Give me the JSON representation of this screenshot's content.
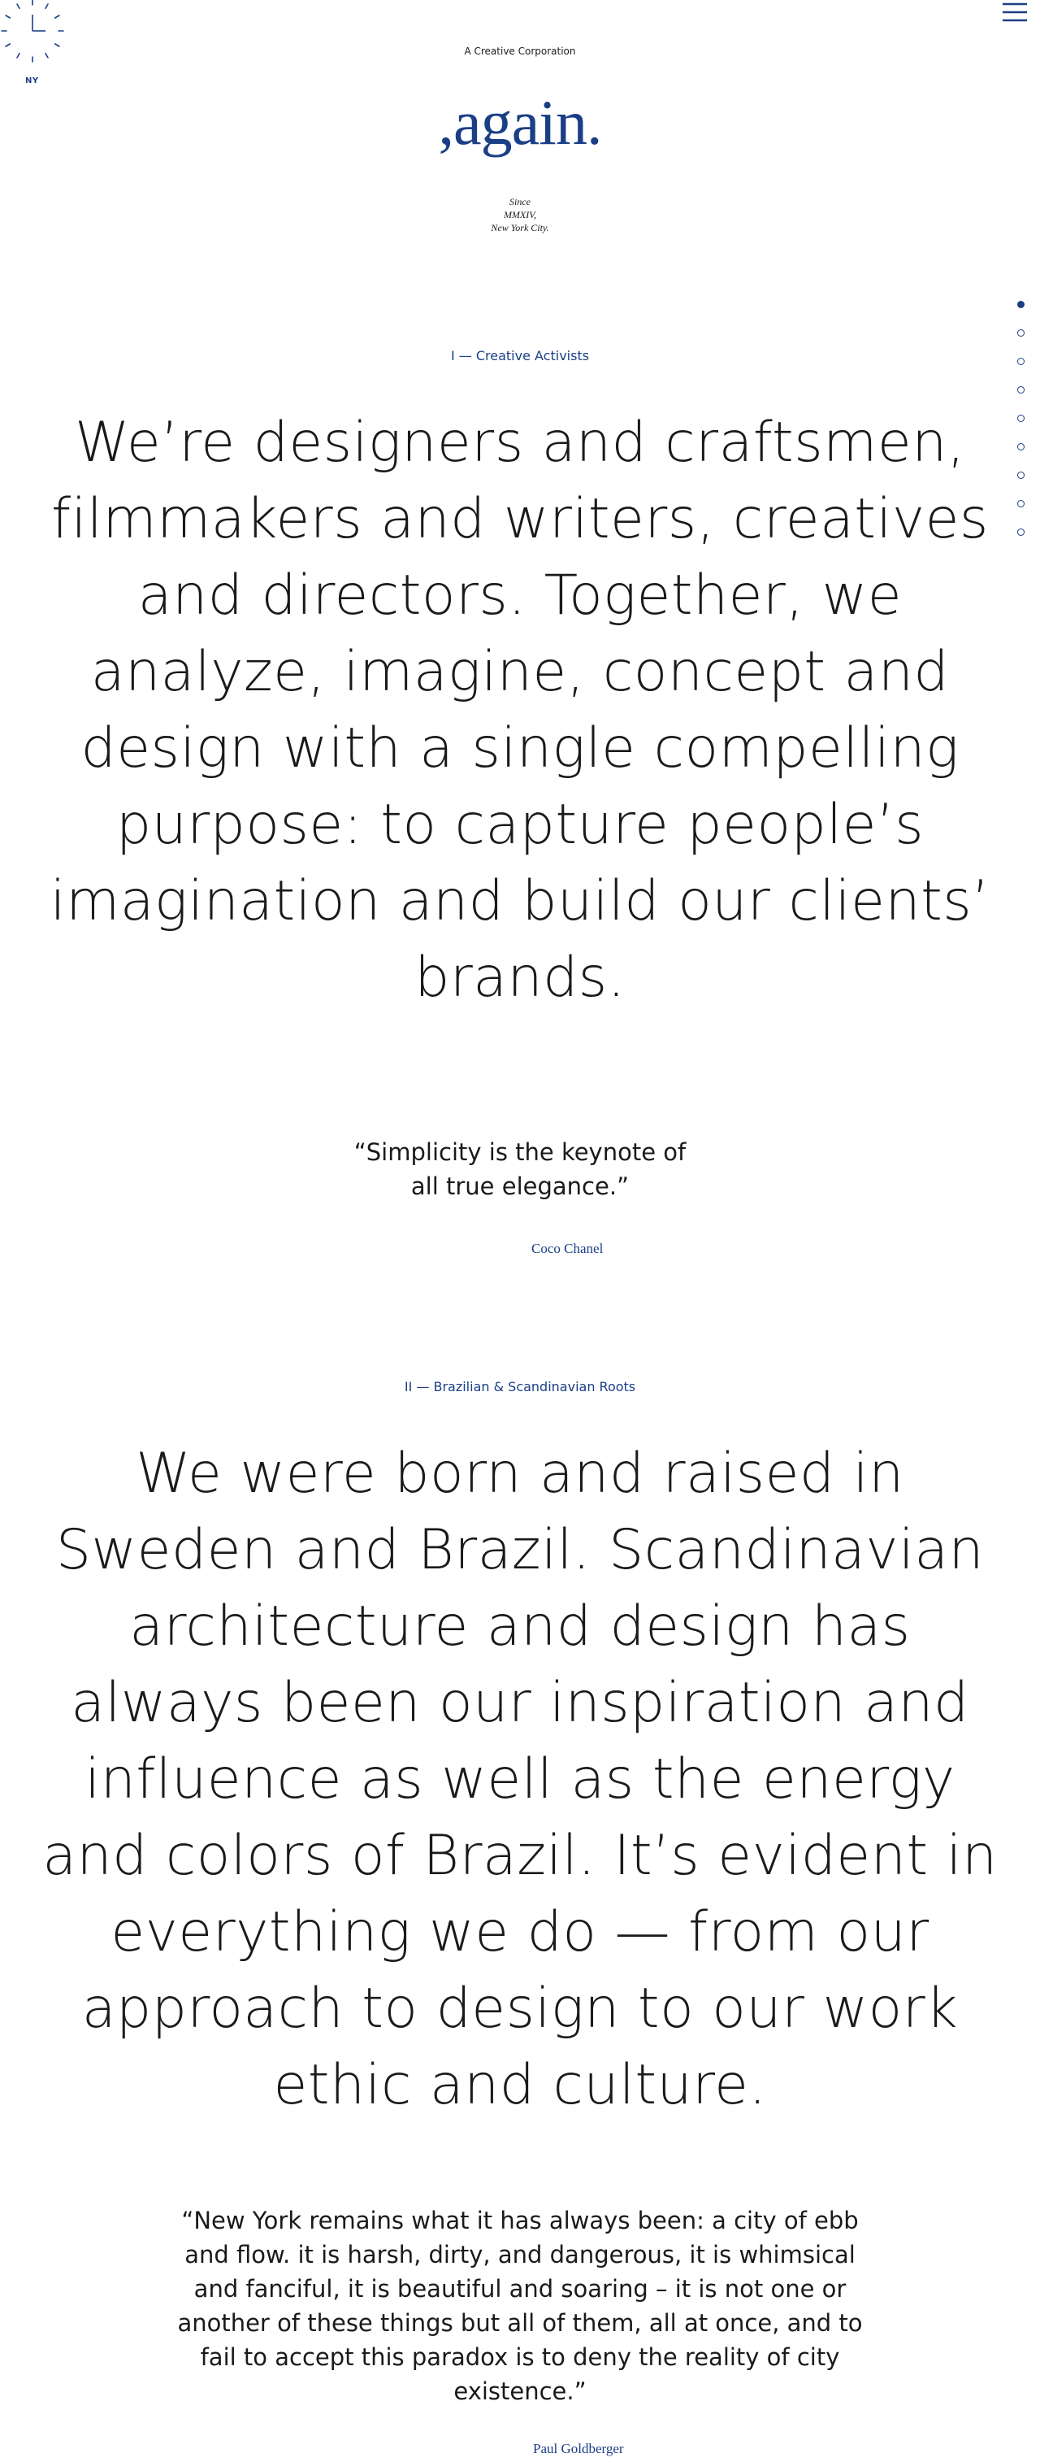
{
  "clock": {
    "city": "NY"
  },
  "header": {
    "tagline": "A Creative Corporation",
    "logo": ",again.",
    "since_line1": "Since",
    "since_line2": "MMXIV,",
    "since_line3": "New York City."
  },
  "nav": {
    "menu_icon": "hamburger-icon",
    "section_dots": 9,
    "active_dot": 0
  },
  "sections": [
    {
      "label": "I —  Creative Activists",
      "statement": "We’re designers and craftsmen, filmmakers and writers, creatives and directors. Together, we analyze, imagine, concept and design with a single compelling purpose: to capture people’s imagination and build our clients’ brands.",
      "quote": "“Simplicity is the keynote of all true elegance.”",
      "author": "Coco Chanel"
    },
    {
      "label": "II —  Brazilian & Scandinavian Roots",
      "statement": "We were born and raised in Sweden and Brazil. Scandinavian architecture and design has always been our inspiration and influence as well as the energy and colors of Brazil. It’s evident in everything we do — from our approach to design to our work ethic and culture.",
      "quote": "“New York remains what it has always been: a city of ebb and flow. it is harsh, dirty, and dangerous, it is whimsical and fanciful, it is beautiful and soaring – it is not one or another of these things but all of them, all at once, and to fail to accept this paradox is to deny the reality of city existence.”",
      "author": "Paul Goldberger"
    }
  ],
  "colors": {
    "accent": "#1b3f86",
    "text": "#1a1a1a",
    "background": "#ffffff"
  }
}
